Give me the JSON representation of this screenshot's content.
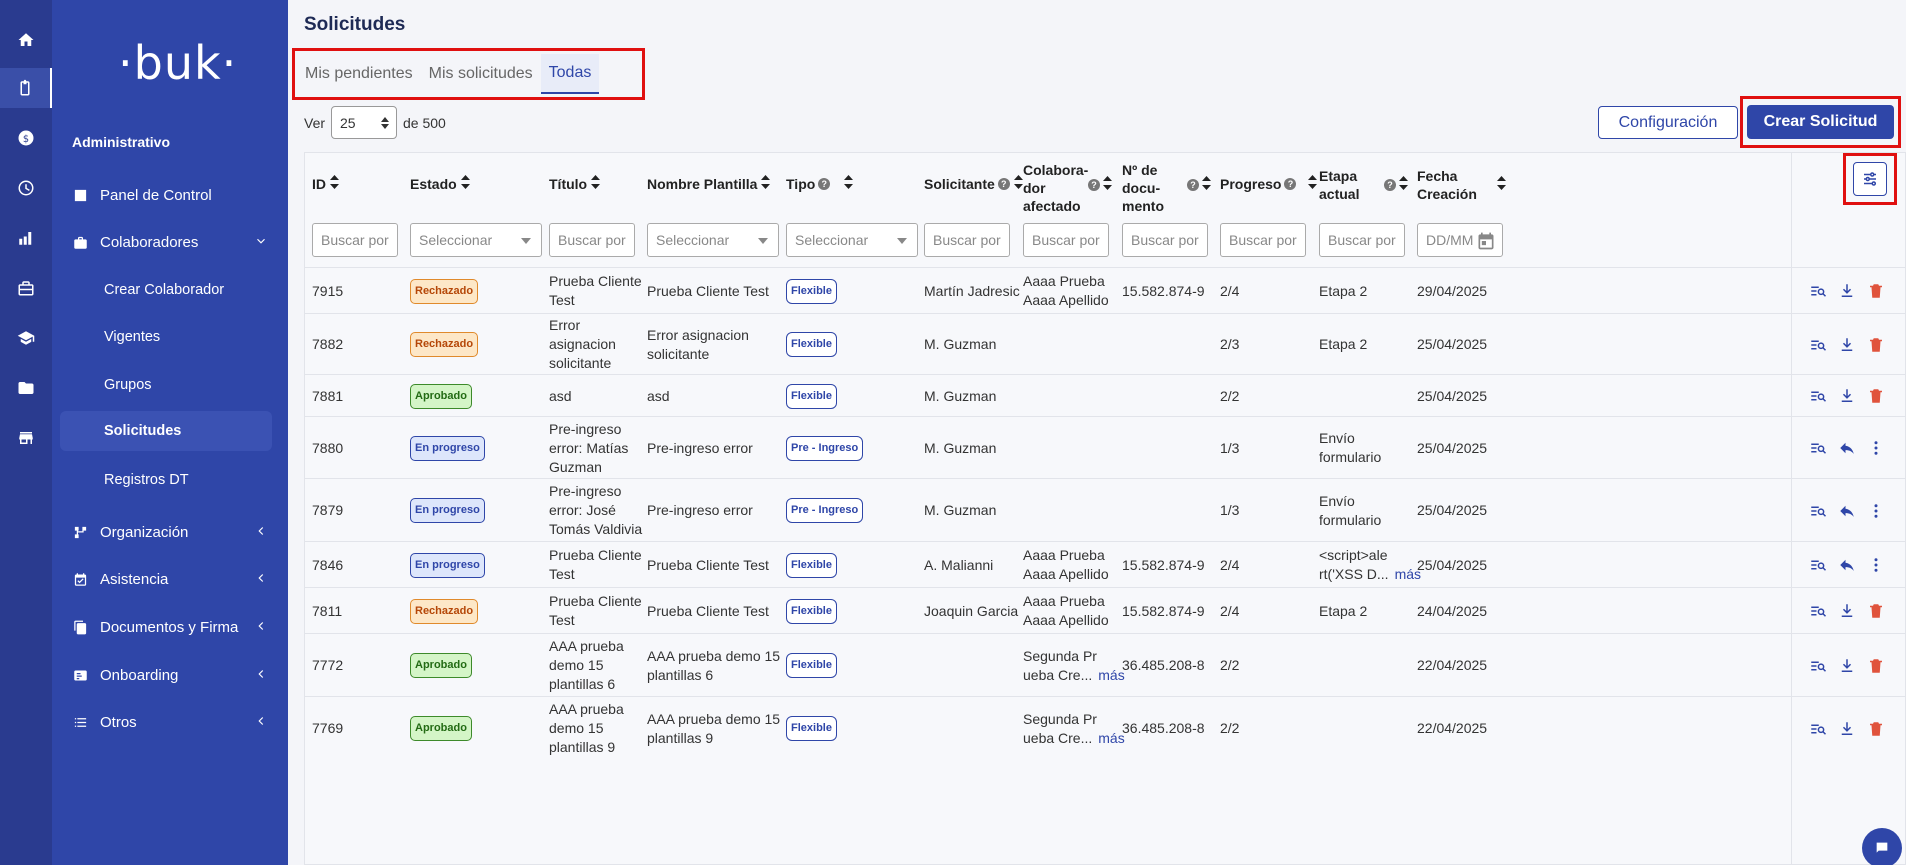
{
  "sidebar": {
    "logo": "·buk·",
    "section_title": "Administrativo",
    "items": [
      {
        "label": "Panel de Control"
      },
      {
        "label": "Colaboradores"
      },
      {
        "label": "Crear Colaborador"
      },
      {
        "label": "Vigentes"
      },
      {
        "label": "Grupos"
      },
      {
        "label": "Solicitudes"
      },
      {
        "label": "Registros DT"
      },
      {
        "label": "Organización"
      },
      {
        "label": "Asistencia"
      },
      {
        "label": "Documentos y Firma"
      },
      {
        "label": "Onboarding"
      },
      {
        "label": "Otros"
      }
    ]
  },
  "header": {
    "title": "Solicitudes",
    "tabs": [
      "Mis pendientes",
      "Mis solicitudes",
      "Todas"
    ],
    "ver_label": "Ver",
    "per_page": "25",
    "total_label": "de 500",
    "config_label": "Configuración",
    "crear_label": "Crear Solicitud"
  },
  "table": {
    "headers": {
      "id": "ID",
      "estado": "Estado",
      "titulo": "Título",
      "plantilla": "Nombre Plantilla",
      "tipo": "Tipo",
      "solicitante": "Solicitante",
      "colab_1": "Colabora-",
      "colab_2": "dor",
      "colab_3": "afectado",
      "doc_1": "Nº de",
      "doc_2": "docu-",
      "doc_3": "mento",
      "progreso": "Progreso",
      "etapa_1": "Etapa",
      "etapa_2": "actual",
      "fecha_1": "Fecha",
      "fecha_2": "Creación"
    },
    "filters": {
      "search": "Buscar por",
      "select": "Seleccionar",
      "date": "DD/MM"
    },
    "more_label": "más",
    "rows": [
      {
        "id": "7915",
        "estado": "Rechazado",
        "t1": "Prueba Cliente",
        "t2": "Test",
        "t3": "",
        "p1": "Prueba Cliente Test",
        "p2": "",
        "tipo": "Flexible",
        "solicitante": "Martín Jadresic",
        "c1": "Aaaa Prueba",
        "c2": "Aaaa Apellido",
        "doc": "15.582.874-9",
        "progreso": "2/4",
        "e1": "Etapa 2",
        "e2": "",
        "fecha": "29/04/2025"
      },
      {
        "id": "7882",
        "estado": "Rechazado",
        "t1": "Error",
        "t2": "asignacion",
        "t3": "solicitante",
        "p1": "Error asignacion",
        "p2": "solicitante",
        "tipo": "Flexible",
        "solicitante": "M. Guzman",
        "c1": "",
        "c2": "",
        "doc": "",
        "progreso": "2/3",
        "e1": "Etapa 2",
        "e2": "",
        "fecha": "25/04/2025"
      },
      {
        "id": "7881",
        "estado": "Aprobado",
        "t1": "asd",
        "t2": "",
        "t3": "",
        "p1": "asd",
        "p2": "",
        "tipo": "Flexible",
        "solicitante": "M. Guzman",
        "c1": "",
        "c2": "",
        "doc": "",
        "progreso": "2/2",
        "e1": "",
        "e2": "",
        "fecha": "25/04/2025"
      },
      {
        "id": "7880",
        "estado": "En progreso",
        "t1": "Pre-ingreso",
        "t2": "error: Matías",
        "t3": "Guzman",
        "p1": "Pre-ingreso error",
        "p2": "",
        "tipo": "Pre - Ingreso",
        "solicitante": "M. Guzman",
        "c1": "",
        "c2": "",
        "doc": "",
        "progreso": "1/3",
        "e1": "Envío",
        "e2": "formulario",
        "fecha": "25/04/2025"
      },
      {
        "id": "7879",
        "estado": "En progreso",
        "t1": "Pre-ingreso",
        "t2": "error: José",
        "t3": "Tomás Valdivia",
        "p1": "Pre-ingreso error",
        "p2": "",
        "tipo": "Pre - Ingreso",
        "solicitante": "M. Guzman",
        "c1": "",
        "c2": "",
        "doc": "",
        "progreso": "1/3",
        "e1": "Envío",
        "e2": "formulario",
        "fecha": "25/04/2025"
      },
      {
        "id": "7846",
        "estado": "En progreso",
        "t1": "Prueba Cliente",
        "t2": "Test",
        "t3": "",
        "p1": "Prueba Cliente Test",
        "p2": "",
        "tipo": "Flexible",
        "solicitante": "A. Malianni",
        "c1": "Aaaa Prueba",
        "c2": "Aaaa Apellido",
        "doc": "15.582.874-9",
        "progreso": "2/4",
        "e1": "<script>ale",
        "e2": "rt('XSS D...",
        "fecha": "25/04/2025"
      },
      {
        "id": "7811",
        "estado": "Rechazado",
        "t1": "Prueba Cliente",
        "t2": "Test",
        "t3": "",
        "p1": "Prueba Cliente Test",
        "p2": "",
        "tipo": "Flexible",
        "solicitante": "Joaquin Garcia",
        "c1": "Aaaa Prueba",
        "c2": "Aaaa Apellido",
        "doc": "15.582.874-9",
        "progreso": "2/4",
        "e1": "Etapa 2",
        "e2": "",
        "fecha": "24/04/2025"
      },
      {
        "id": "7772",
        "estado": "Aprobado",
        "t1": "AAA prueba",
        "t2": "demo 15",
        "t3": "plantillas 6",
        "p1": "AAA prueba demo 15",
        "p2": "plantillas 6",
        "tipo": "Flexible",
        "solicitante": "",
        "c1": "Segunda Pr",
        "c2": "ueba Cre...",
        "doc": "36.485.208-8",
        "progreso": "2/2",
        "e1": "",
        "e2": "",
        "fecha": "22/04/2025"
      },
      {
        "id": "7769",
        "estado": "Aprobado",
        "t1": "AAA prueba",
        "t2": "demo 15",
        "t3": "plantillas 9",
        "p1": "AAA prueba demo 15",
        "p2": "plantillas 9",
        "tipo": "Flexible",
        "solicitante": "",
        "c1": "Segunda Pr",
        "c2": "ueba Cre...",
        "doc": "36.485.208-8",
        "progreso": "2/2",
        "e1": "",
        "e2": "",
        "fecha": "22/04/2025"
      }
    ]
  },
  "colors": {
    "primary": "#2f46a8",
    "rail": "#2a3b8f",
    "highlight": "#e01010",
    "delete": "#e0533c"
  }
}
